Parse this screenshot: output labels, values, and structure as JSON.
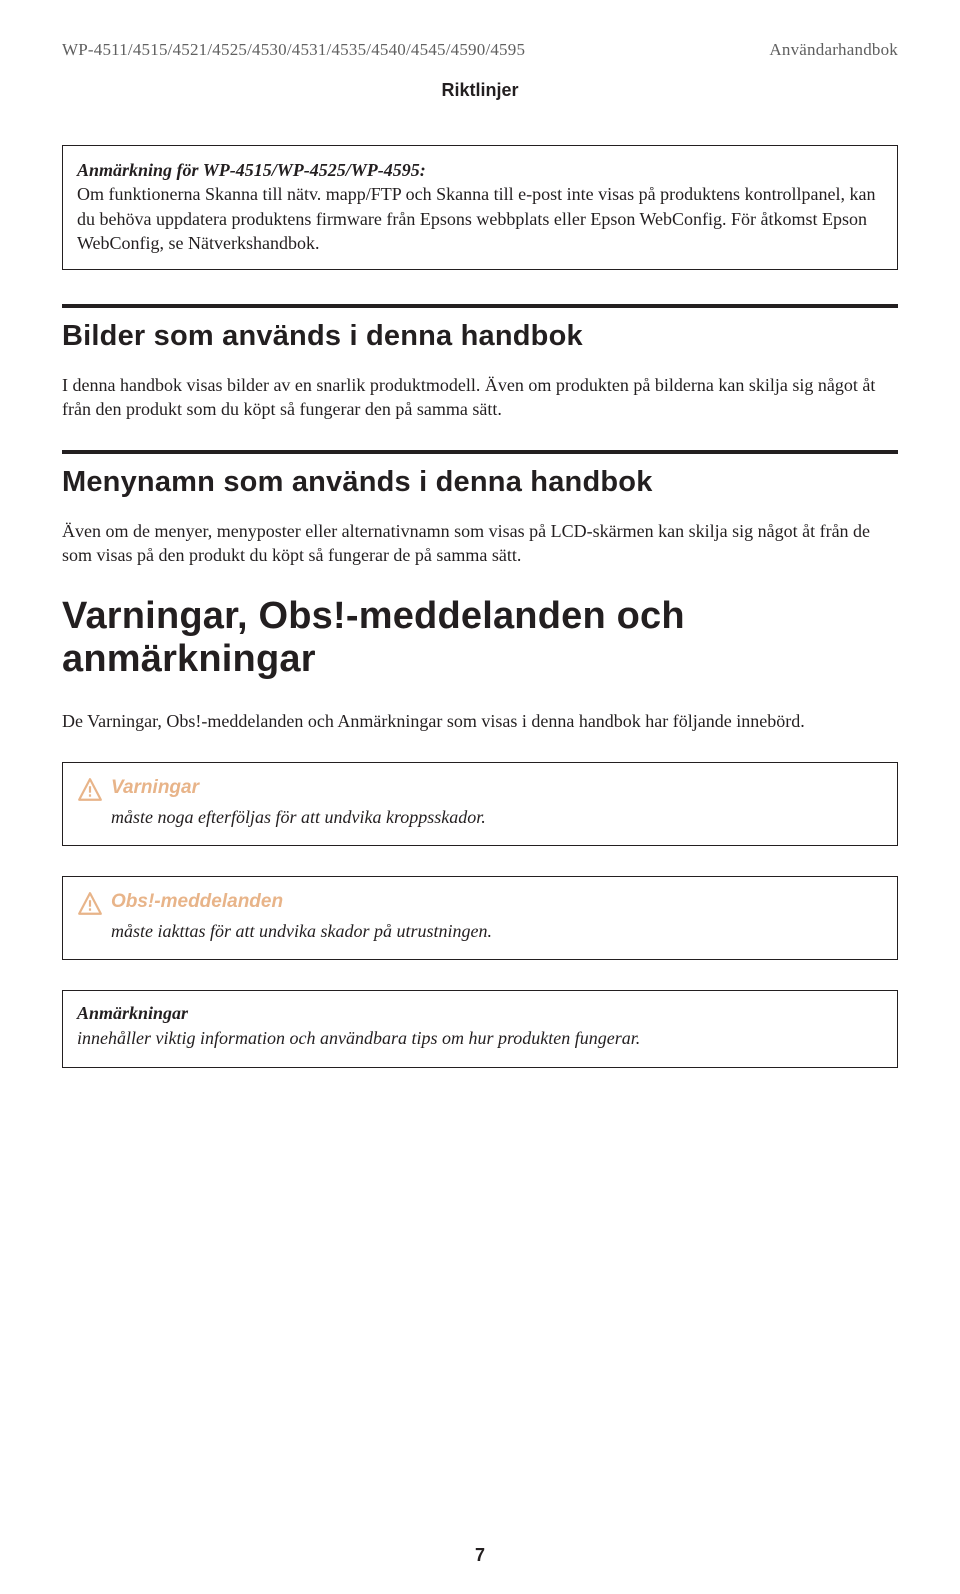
{
  "header": {
    "models": "WP-4511/4515/4521/4525/4530/4531/4535/4540/4545/4590/4595",
    "doc_type": "Användarhandbok",
    "section": "Riktlinjer"
  },
  "intro_note": {
    "line1_strong": "Anmärkning för WP-4515/WP-4525/WP-4595:",
    "line2": "Om funktionerna Skanna till nätv. mapp/FTP och Skanna till e-post inte visas på produktens kontrollpanel, kan du behöva uppdatera produktens firmware från Epsons webbplats eller Epson WebConfig. För åtkomst Epson WebConfig, se Nätverkshandbok."
  },
  "section1": {
    "heading": "Bilder som används i denna handbok",
    "body": "I denna handbok visas bilder av en snarlik produktmodell. Även om produkten på bilderna kan skilja sig något åt från den produkt som du köpt så fungerar den på samma sätt."
  },
  "section2": {
    "heading": "Menynamn som används i denna handbok",
    "body": "Även om de menyer, menyposter eller alternativnamn som visas på LCD-skärmen kan skilja sig något åt från de som visas på den produkt du köpt så fungerar de på samma sätt."
  },
  "warnings": {
    "heading": "Varningar, Obs!-meddelanden och anmärkningar",
    "intro": "De Varningar, Obs!-meddelanden och Anmärkningar som visas i denna handbok har följande innebörd.",
    "box1": {
      "lead": "Varningar",
      "text": "måste noga efterföljas för att undvika kroppsskador."
    },
    "box2": {
      "lead": "Obs!-meddelanden",
      "text": "måste iakttas för att undvika skador på utrustningen."
    },
    "box3": {
      "lead": "Anmärkningar",
      "text": "innehåller viktig information och användbara tips om hur produkten fungerar."
    }
  },
  "page_number": "7"
}
